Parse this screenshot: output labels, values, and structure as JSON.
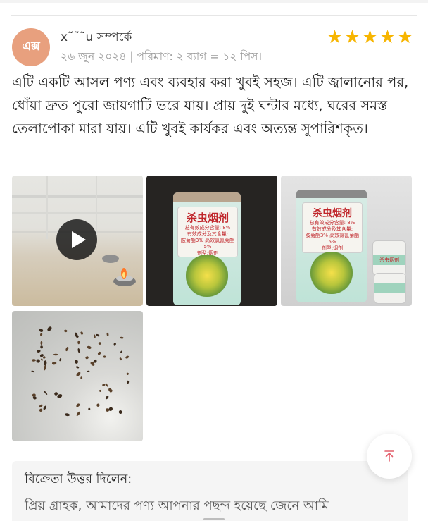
{
  "review": {
    "avatar_text": "এক্স",
    "author": "x˜˜˜u সম্পর্কে",
    "date": "২৬ জুন ২০২৪",
    "separator": "|",
    "quantity": "পরিমাণ: ২ ব্যাগ = ১২ পিস।",
    "rating": 5,
    "star_glyph": "★",
    "text": "এটি একটি আসল পণ্য এবং ব্যবহার করা খুবই সহজ। এটি জ্বালানোর পর, ধোঁয়া দ্রুত পুরো জায়গাটি ভরে যায়। প্রায় দুই ঘন্টার মধ্যে, ঘরের সমস্ত তেলাপোকা মারা যায়। এটি খুবই কার্যকর এবং অত্যন্ত সুপারিশকৃত।"
  },
  "media": {
    "video_thumb": {
      "icon": "play-icon"
    },
    "product_photo_1": {
      "title": "杀虫烟剂",
      "lines": [
        "总有效成分含量: 8%",
        "有效成分及其含量:",
        "胺菊酯3% 高效氯氰菊酯5%",
        "剂型:烟剂"
      ]
    },
    "product_photo_2": {
      "title": "杀虫烟剂",
      "lines": [
        "总有效成分含量: 8%",
        "有效成分及其含量:",
        "胺菊酯3% 高效氯氰菊酯5%",
        "剂型:烟剂"
      ],
      "can_label": "杀虫烟剂"
    },
    "result_photo": {
      "icon": "dead-insects-photo"
    }
  },
  "seller_reply": {
    "title": "বিক্রেতা উত্তর দিলেন:",
    "text": "প্রিয় গ্রাহক, আমাদের পণ্য আপনার পছন্দ হয়েছে জেনে আমি"
  },
  "controls": {
    "scroll_top_icon": "arrow-up-to-top-icon"
  },
  "colors": {
    "avatar": "#e8a07e",
    "star": "#f7b500",
    "scroll_top_arrow": "#e4606d",
    "meta_text": "#9a9a9a",
    "reply_bg": "#f5f5f5"
  }
}
